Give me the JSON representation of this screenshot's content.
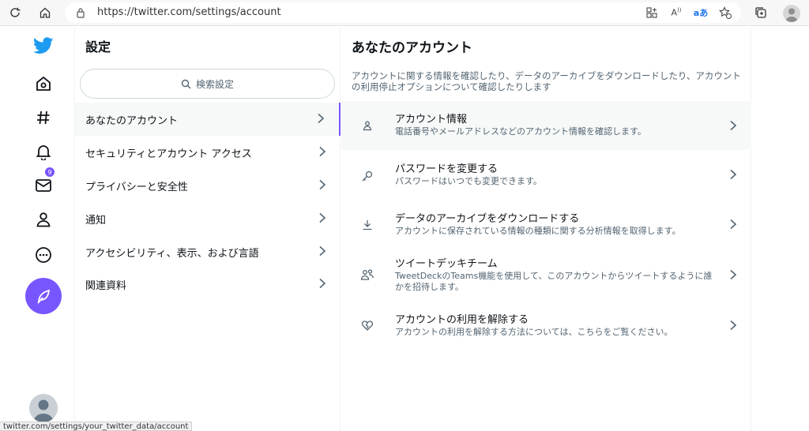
{
  "browser": {
    "url": "https://twitter.com/settings/account",
    "translate_label": "aあ"
  },
  "leftnav": {
    "notification_count": "9"
  },
  "settings": {
    "title": "設定",
    "search_placeholder": "検索設定",
    "items": [
      {
        "label": "あなたのアカウント"
      },
      {
        "label": "セキュリティとアカウント アクセス"
      },
      {
        "label": "プライバシーと安全性"
      },
      {
        "label": "通知"
      },
      {
        "label": "アクセシビリティ、表示、および言語"
      },
      {
        "label": "関連資料"
      }
    ]
  },
  "account": {
    "title": "あなたのアカウント",
    "description": "アカウントに関する情報を確認したり、データのアーカイブをダウンロードしたり、アカウントの利用停止オプションについて確認したりします",
    "items": [
      {
        "title": "アカウント情報",
        "subtitle": "電話番号やメールアドレスなどのアカウント情報を確認します。",
        "icon": "person-icon"
      },
      {
        "title": "パスワードを変更する",
        "subtitle": "パスワードはいつでも変更できます。",
        "icon": "key-icon"
      },
      {
        "title": "データのアーカイブをダウンロードする",
        "subtitle": "アカウントに保存されている情報の種類に関する分析情報を取得します。",
        "icon": "download-icon"
      },
      {
        "title": "ツイートデッキチーム",
        "subtitle": "TweetDeckのTeams機能を使用して、このアカウントからツイートするように誰かを招待します。",
        "icon": "people-icon"
      },
      {
        "title": "アカウントの利用を解除する",
        "subtitle": "アカウントの利用を解除する方法については、こちらをご覧ください。",
        "icon": "broken-heart-icon"
      }
    ]
  },
  "status_bar": {
    "text": "twitter.com/settings/your_twitter_data/account"
  },
  "colors": {
    "accent": "#7856ff",
    "twitter_blue": "#1d9bf0"
  }
}
